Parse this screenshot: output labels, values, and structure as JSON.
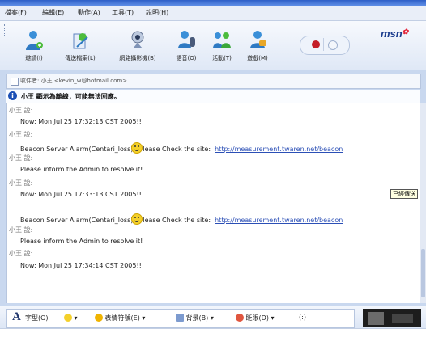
{
  "menu": [
    "檔案(F)",
    "編輯(E)",
    "動作(A)",
    "工具(T)",
    "說明(H)"
  ],
  "toolbar": {
    "buttons": [
      {
        "label": "邀請(I)",
        "icon": "invite-person-icon"
      },
      {
        "label": "傳送檔案(L)",
        "icon": "send-file-icon"
      },
      {
        "label": "網路攝影機(B)",
        "icon": "webcam-icon"
      },
      {
        "label": "語音(O)",
        "icon": "voice-icon"
      },
      {
        "label": "活動(T)",
        "icon": "activities-icon"
      },
      {
        "label": "遊戲(M)",
        "icon": "games-icon"
      }
    ],
    "brand": "msn"
  },
  "to_line": "收件者: 小王 <kevin_w@hotmail.com>",
  "notice": "小王 顯示為離線，可能無法回應。",
  "messages": [
    {
      "sender": "小王 說:",
      "text": "Now: Mon Jul 25 17:32:13 CST 2005!!"
    },
    {
      "sender": "小王 說:",
      "text_before": "Beacon Server Alarm(Centari_loss)",
      "text_after": "lease Check the site:",
      "link": "http://measurement.twaren.net/beacon"
    },
    {
      "sender": "小王 說:",
      "text": "Please inform the Admin to resolve it!"
    },
    {
      "sender": "小王 說:",
      "text": "Now: Mon Jul 25 17:33:13 CST 2005!!"
    },
    {
      "sender": "",
      "text_before": "Beacon Server Alarm(Centari_loss)",
      "text_after": "lease Check the site:",
      "link": "http://measurement.twaren.net/beacon"
    },
    {
      "sender": "小王 說:",
      "text": "Please inform the Admin to resolve it!"
    },
    {
      "sender": "小王 說:",
      "text": "Now: Mon Jul 25 17:34:14 CST 2005!!"
    }
  ],
  "tooltip": "已經傳送",
  "format_bar": {
    "font": "字型(O)",
    "emoticons": "表情符號(E)",
    "background": "背景(B)",
    "wink": "眨眼(D)",
    "extra": "(:)"
  },
  "colors": {
    "accent": "#2e5fc7",
    "link": "#2b4fb6",
    "alert": "#c41e28"
  }
}
